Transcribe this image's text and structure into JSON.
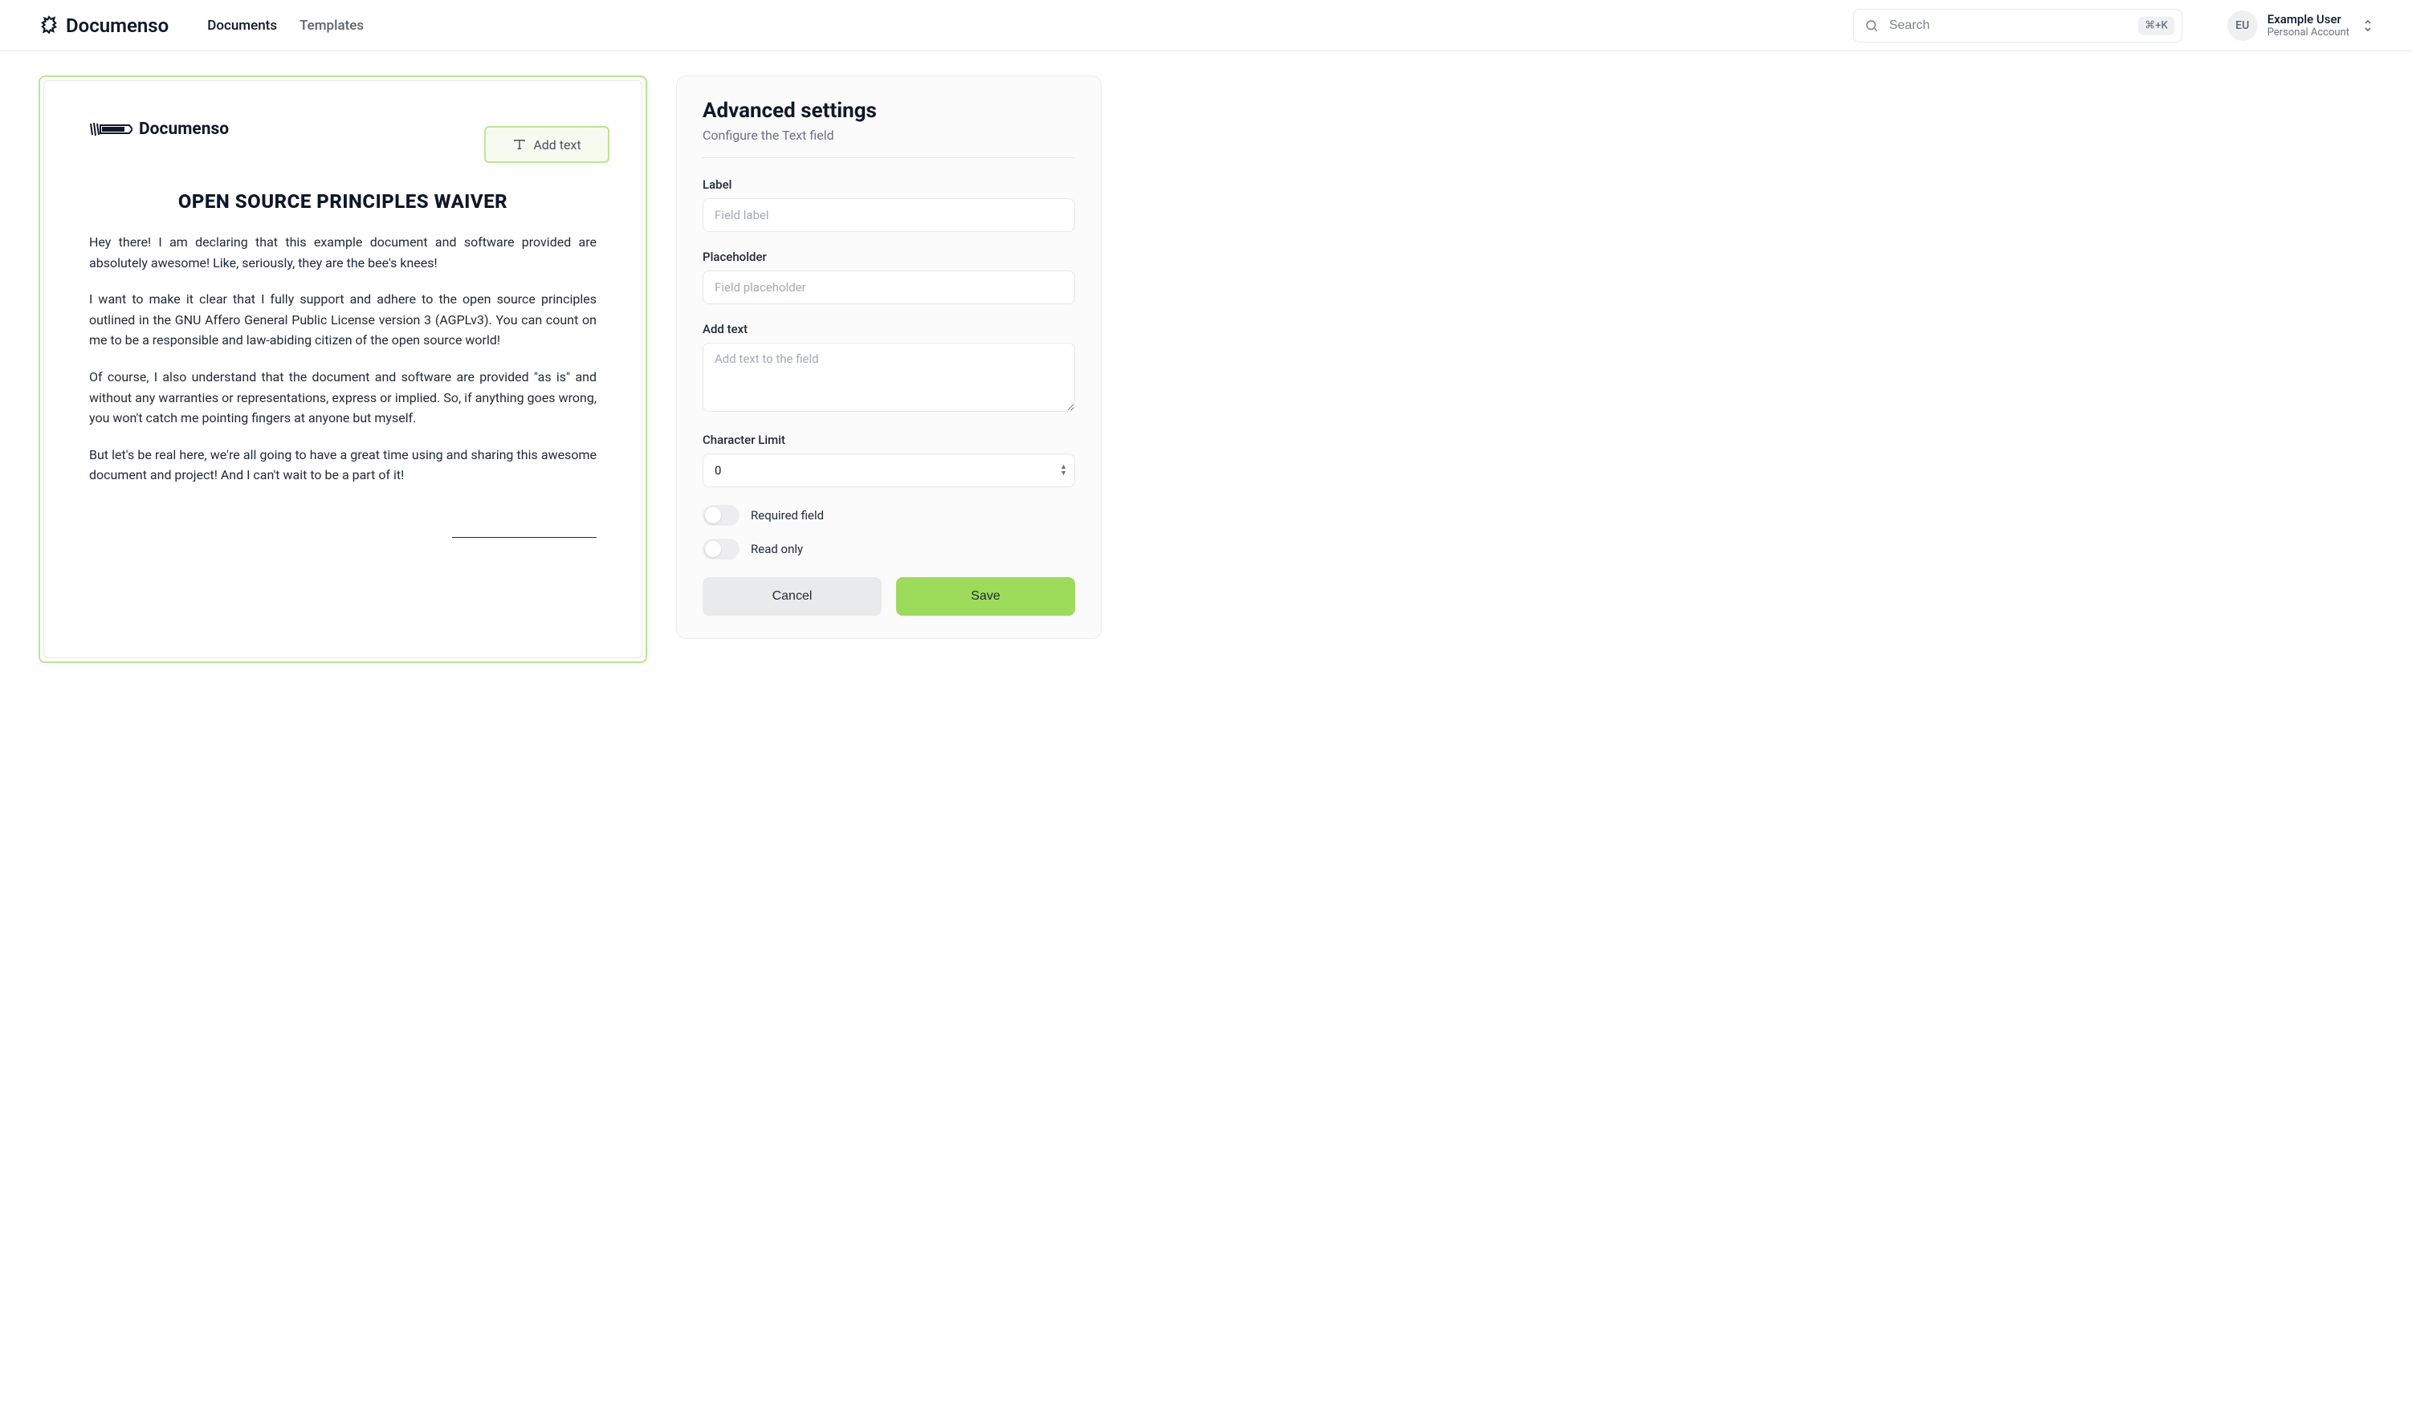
{
  "header": {
    "brand": "Documenso",
    "nav": {
      "documents": "Documents",
      "templates": "Templates",
      "active": "documents"
    },
    "search": {
      "placeholder": "Search",
      "shortcut": "⌘+K"
    },
    "user": {
      "initials": "EU",
      "name": "Example User",
      "sub": "Personal Account"
    }
  },
  "document": {
    "brand": "Documenso",
    "field_button": "Add text",
    "title": "OPEN SOURCE PRINCIPLES WAIVER",
    "paragraphs": [
      "Hey there! I am declaring that this example document and software provided are absolutely awesome! Like, seriously, they are the bee's knees!",
      "I want to make it clear that I fully support and adhere to the open source principles outlined in the GNU Affero General Public License version 3 (AGPLv3). You can count on me to be a responsible and law-abiding citizen of the open source world!",
      "Of course, I also understand that the document and software are provided \"as is\" and without any warranties or representations, express or implied. So, if anything goes wrong, you won't catch me pointing fingers at anyone but myself.",
      "But let's be real here, we're all going to have a great time using and sharing this awesome document and project! And I can't wait to be a part of it!"
    ]
  },
  "settings": {
    "title": "Advanced settings",
    "subtitle": "Configure the Text field",
    "labels": {
      "label": "Label",
      "placeholder": "Placeholder",
      "addtext": "Add text",
      "charlimit": "Character Limit",
      "required": "Required field",
      "readonly": "Read only"
    },
    "placeholders": {
      "label": "Field label",
      "placeholder": "Field placeholder",
      "addtext": "Add text to the field"
    },
    "values": {
      "charlimit": "0",
      "required": false,
      "readonly": false
    },
    "buttons": {
      "cancel": "Cancel",
      "save": "Save"
    }
  }
}
